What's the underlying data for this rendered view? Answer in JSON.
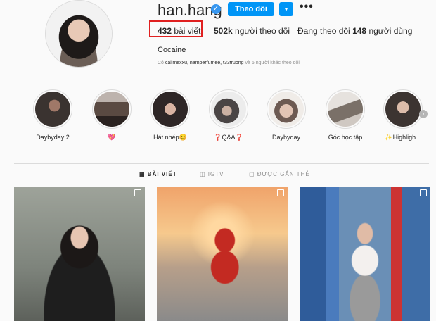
{
  "profile": {
    "username": "han.hang",
    "follow_label": "Theo dõi",
    "dropdown_icon": "▾",
    "more_icon": "•••",
    "verified_icon": "✓",
    "stats": {
      "posts_count": "432",
      "posts_label": "bài viết",
      "followers_count": "502k",
      "followers_label": "người theo dõi",
      "following_prefix": "Đang theo dõi",
      "following_count": "148",
      "following_label": "người dùng"
    },
    "bio_name": "Cocaine",
    "followed_by": {
      "prefix": "Có",
      "names": "callmexxu, namperfumee, t33truong",
      "suffix": "và 6 người khác theo dõi"
    }
  },
  "highlights": [
    {
      "label": "Daybyday 2",
      "color": "#3a3330"
    },
    {
      "label": "💖",
      "color": "#5a4a42"
    },
    {
      "label": "Hát nhép😊",
      "color": "#2e2626"
    },
    {
      "label": "❓Q&A❓",
      "color": "#4a4545"
    },
    {
      "label": "Daybyday",
      "color": "#6d5a52"
    },
    {
      "label": "Góc học tập",
      "color": "#7a7068"
    },
    {
      "label": "✨Highligh...",
      "color": "#3c3431"
    }
  ],
  "tabs": [
    {
      "label": "BÀI VIẾT",
      "icon": "▦"
    },
    {
      "label": "IGTV",
      "icon": "◫"
    },
    {
      "label": "ĐƯỢC GẮN THẺ",
      "icon": "▢"
    }
  ],
  "accent_color": "#0095f6",
  "highlight_box_color": "#e02020"
}
